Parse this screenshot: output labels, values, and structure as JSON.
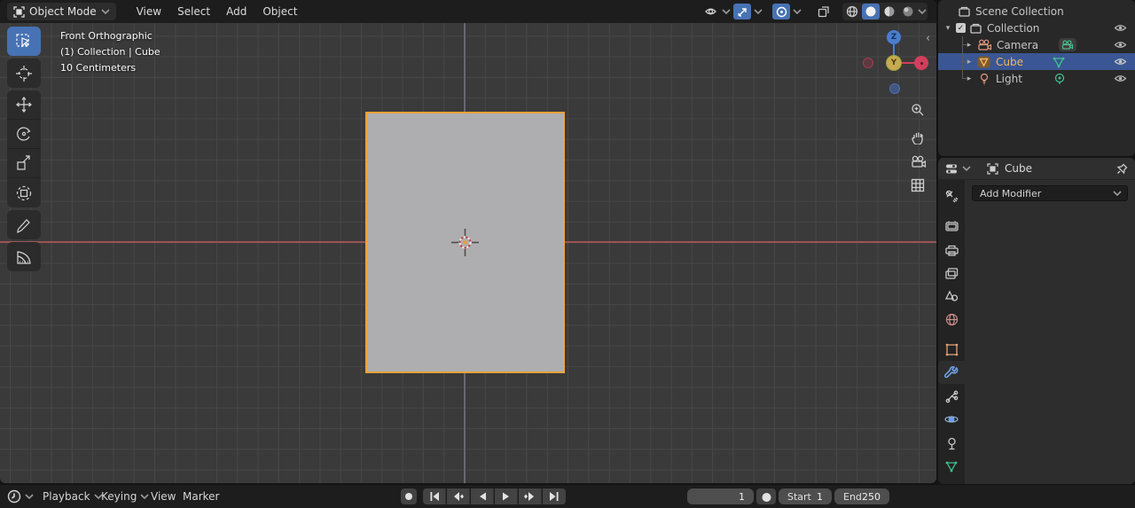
{
  "viewport": {
    "header": {
      "mode": "Object Mode",
      "menus": [
        "View",
        "Select",
        "Add",
        "Object"
      ]
    },
    "overlay": {
      "view": "Front Orthographic",
      "context": "(1) Collection | Cube",
      "scale": "10 Centimeters"
    },
    "gizmo": {
      "z": "Z",
      "y": "Y"
    }
  },
  "outliner": {
    "scene_collection": "Scene Collection",
    "collection": "Collection",
    "camera": "Camera",
    "cube": "Cube",
    "light": "Light"
  },
  "properties": {
    "breadcrumb": "Cube",
    "add_modifier": "Add Modifier"
  },
  "timeline": {
    "playback": "Playback",
    "keying": "Keying",
    "view": "View",
    "marker": "Marker",
    "frame_current": "1",
    "start_label": "Start",
    "start_value": "1",
    "end_label": "End",
    "end_value": "250"
  },
  "glyphs": {
    "tri_down": "▾",
    "tri_right": "▸",
    "collapse_left": "‹",
    "check": "✓"
  },
  "colors": {
    "accent": "#4772b3",
    "selection": "#3a5694",
    "object_outline": "#f0a33a",
    "axis_x": "#9b5454",
    "viewport_bg": "#3a3a3a"
  }
}
